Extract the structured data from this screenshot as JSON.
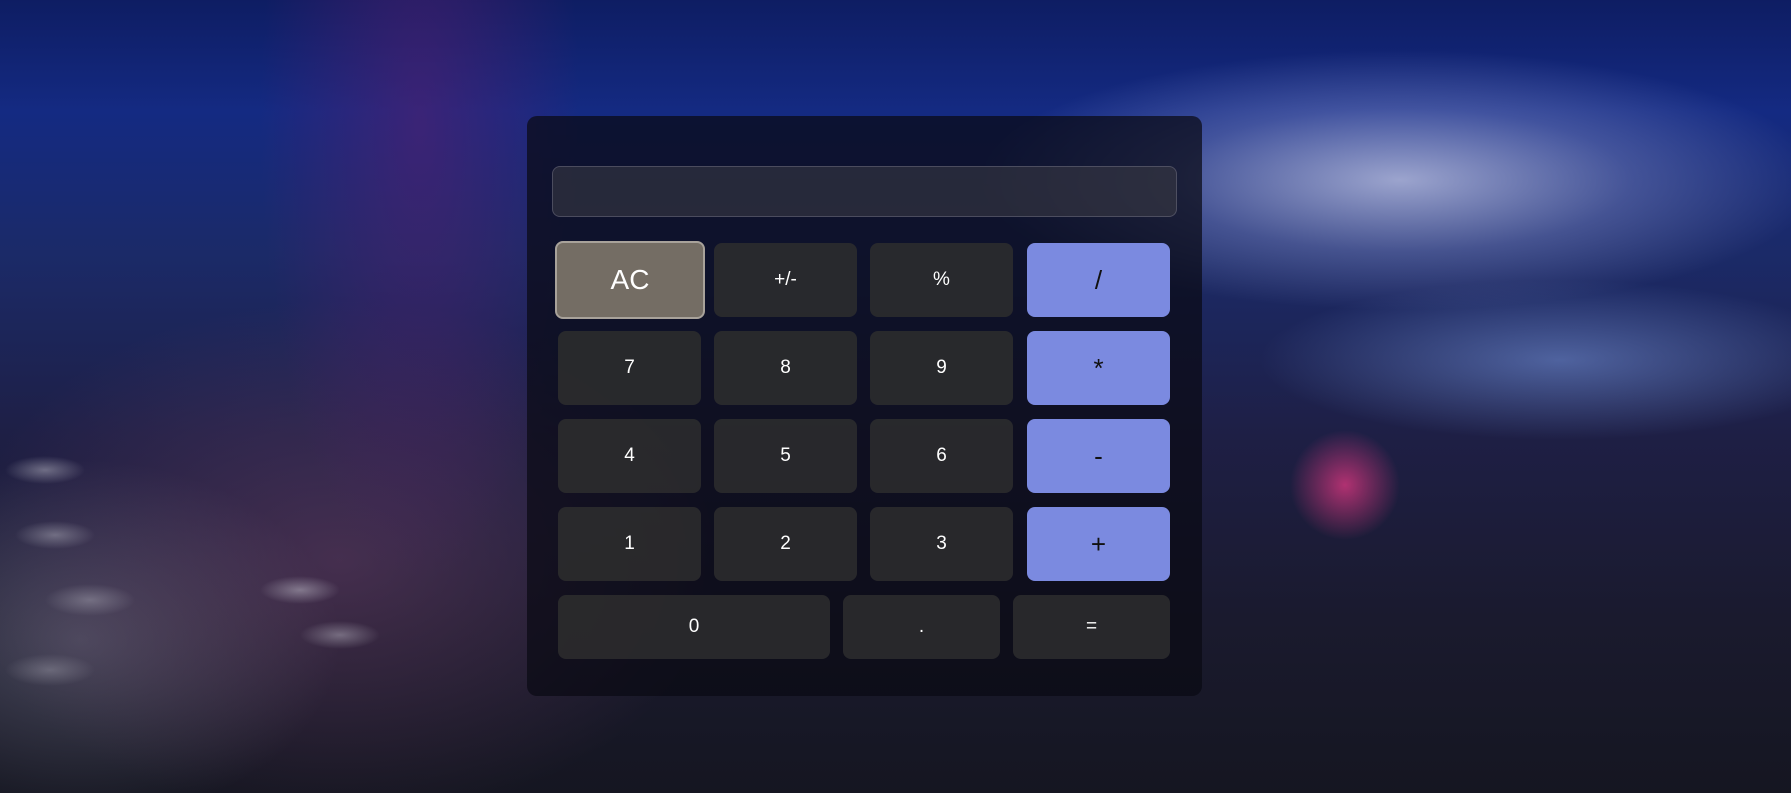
{
  "display": {
    "value": "",
    "placeholder": ""
  },
  "buttons": {
    "clear": "AC",
    "sign": "+/-",
    "percent": "%",
    "divide": "/",
    "seven": "7",
    "eight": "8",
    "nine": "9",
    "multiply": "*",
    "four": "4",
    "five": "5",
    "six": "6",
    "subtract": "-",
    "one": "1",
    "two": "2",
    "three": "3",
    "add": "+",
    "zero": "0",
    "decimal": ".",
    "equals": "="
  },
  "colors": {
    "operator": "#7b8ae0",
    "clear": "#746d64",
    "digit": "#2c2c2e",
    "panel": "#0a0a14"
  }
}
